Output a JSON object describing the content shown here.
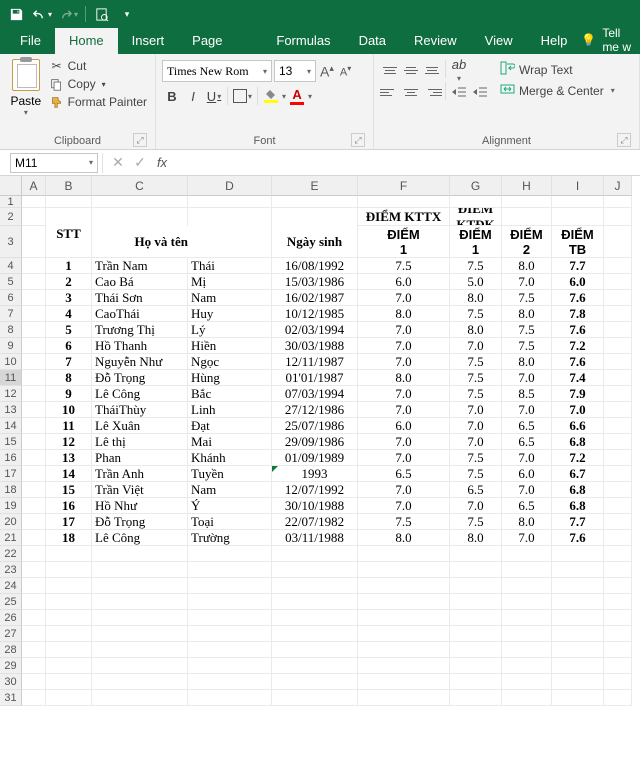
{
  "tabs": {
    "file": "File",
    "home": "Home",
    "insert": "Insert",
    "pagelayout": "Page Layout",
    "formulas": "Formulas",
    "data": "Data",
    "review": "Review",
    "view": "View",
    "help": "Help",
    "tellme": "Tell me w"
  },
  "clipboard": {
    "paste": "Paste",
    "cut": "Cut",
    "copy": "Copy",
    "format_painter": "Format Painter",
    "label": "Clipboard"
  },
  "font": {
    "name": "Times New Rom",
    "size": "13",
    "label": "Font"
  },
  "alignment": {
    "wrap": "Wrap Text",
    "merge": "Merge & Center",
    "label": "Alignment"
  },
  "namebox": "M11",
  "columns": [
    "A",
    "B",
    "C",
    "D",
    "E",
    "F",
    "G",
    "H",
    "I",
    "J"
  ],
  "headers": {
    "stt": "STT",
    "hovaten": "Họ và tên",
    "ngaysinh": "Ngày sinh",
    "kttx": "ĐIỂM KTTX",
    "ktdk": "ĐIỂM KTĐK",
    "diem1": "ĐIỂM",
    "diem1b": "1",
    "diemg": "ĐIỂM",
    "diemg1": "1",
    "diemh": "ĐIỂM",
    "diemh2": "2",
    "tb": "ĐIỂM",
    "tbb": "TB"
  },
  "rows": [
    {
      "n": "1",
      "ho": "Trần Nam",
      "ten": "Thái",
      "ns": "16/08/1992",
      "f": "7.5",
      "g": "7.5",
      "h": "8.0",
      "i": "7.7"
    },
    {
      "n": "2",
      "ho": "Cao Bá",
      "ten": "Mị",
      "ns": "15/03/1986",
      "f": "6.0",
      "g": "5.0",
      "h": "7.0",
      "i": "6.0"
    },
    {
      "n": "3",
      "ho": "Thái Sơn",
      "ten": "Nam",
      "ns": "16/02/1987",
      "f": "7.0",
      "g": "8.0",
      "h": "7.5",
      "i": "7.6"
    },
    {
      "n": "4",
      "ho": "CaoThái",
      "ten": "Huy",
      "ns": "10/12/1985",
      "f": "8.0",
      "g": "7.5",
      "h": "8.0",
      "i": "7.8"
    },
    {
      "n": "5",
      "ho": "Trương Thị",
      "ten": "Lý",
      "ns": "02/03/1994",
      "f": "7.0",
      "g": "8.0",
      "h": "7.5",
      "i": "7.6"
    },
    {
      "n": "6",
      "ho": "Hồ Thanh",
      "ten": "Hiền",
      "ns": "30/03/1988",
      "f": "7.0",
      "g": "7.0",
      "h": "7.5",
      "i": "7.2"
    },
    {
      "n": "7",
      "ho": "Nguyễn Như",
      "ten": "Ngọc",
      "ns": "12/11/1987",
      "f": "7.0",
      "g": "7.5",
      "h": "8.0",
      "i": "7.6"
    },
    {
      "n": "8",
      "ho": "Đỗ Trọng",
      "ten": "Hùng",
      "ns": "01'01/1987",
      "f": "8.0",
      "g": "7.5",
      "h": "7.0",
      "i": "7.4"
    },
    {
      "n": "9",
      "ho": "Lê Công",
      "ten": "Bắc",
      "ns": "07/03/1994",
      "f": "7.0",
      "g": "7.5",
      "h": "8.5",
      "i": "7.9"
    },
    {
      "n": "10",
      "ho": "TháiThùy",
      "ten": "Linh",
      "ns": "27/12/1986",
      "f": "7.0",
      "g": "7.0",
      "h": "7.0",
      "i": "7.0"
    },
    {
      "n": "11",
      "ho": "Lê Xuân",
      "ten": "Đạt",
      "ns": "25/07/1986",
      "f": "6.0",
      "g": "7.0",
      "h": "6.5",
      "i": "6.6"
    },
    {
      "n": "12",
      "ho": "Lê thị",
      "ten": "Mai",
      "ns": "29/09/1986",
      "f": "7.0",
      "g": "7.0",
      "h": "6.5",
      "i": "6.8"
    },
    {
      "n": "13",
      "ho": "Phan",
      "ten": "Khánh",
      "ns": "01/09/1989",
      "f": "7.0",
      "g": "7.5",
      "h": "7.0",
      "i": "7.2"
    },
    {
      "n": "14",
      "ho": "Trần Anh",
      "ten": "Tuyền",
      "ns": "1993",
      "f": "6.5",
      "g": "7.5",
      "h": "6.0",
      "i": "6.7",
      "tri": true
    },
    {
      "n": "15",
      "ho": "Trần Việt",
      "ten": "Nam",
      "ns": "12/07/1992",
      "f": "7.0",
      "g": "6.5",
      "h": "7.0",
      "i": "6.8"
    },
    {
      "n": "16",
      "ho": "Hồ Như",
      "ten": "Ý",
      "ns": "30/10/1988",
      "f": "7.0",
      "g": "7.0",
      "h": "6.5",
      "i": "6.8"
    },
    {
      "n": "17",
      "ho": "Đỗ Trọng",
      "ten": "Toại",
      "ns": "22/07/1982",
      "f": "7.5",
      "g": "7.5",
      "h": "8.0",
      "i": "7.7"
    },
    {
      "n": "18",
      "ho": "Lê Công",
      "ten": "Trường",
      "ns": "03/11/1988",
      "f": "8.0",
      "g": "8.0",
      "h": "7.0",
      "i": "7.6"
    }
  ]
}
